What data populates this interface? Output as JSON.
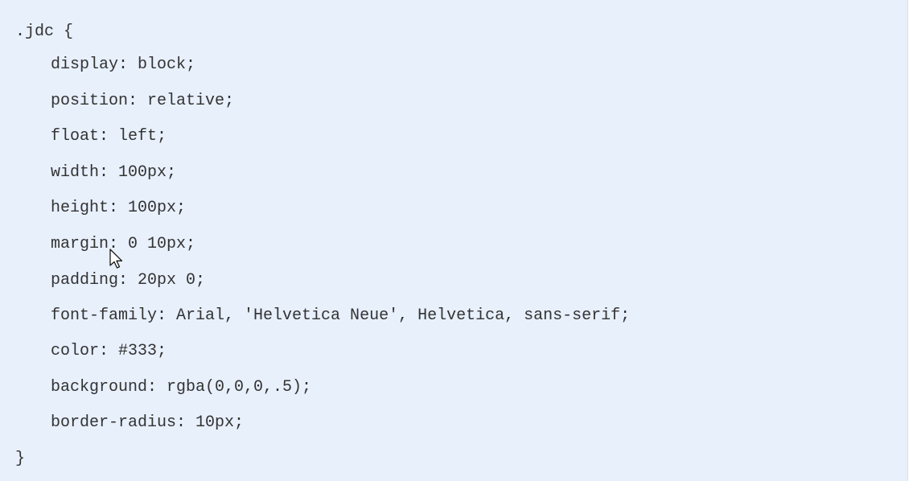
{
  "code_block": {
    "selector_line": ".jdc {",
    "properties": [
      "display: block;",
      "position: relative;",
      "float: left;",
      "width: 100px;",
      "height: 100px;",
      "margin: 0 10px;",
      "padding: 20px 0;",
      "font-family: Arial, 'Helvetica Neue', Helvetica, sans-serif;",
      "color: #333;",
      "background: rgba(0,0,0,.5);",
      "border-radius: 10px;"
    ],
    "closing_line": "}"
  },
  "colors": {
    "background": "#e8f0fc",
    "text": "#333333"
  },
  "cursor": {
    "icon": "mouse-pointer-icon"
  }
}
